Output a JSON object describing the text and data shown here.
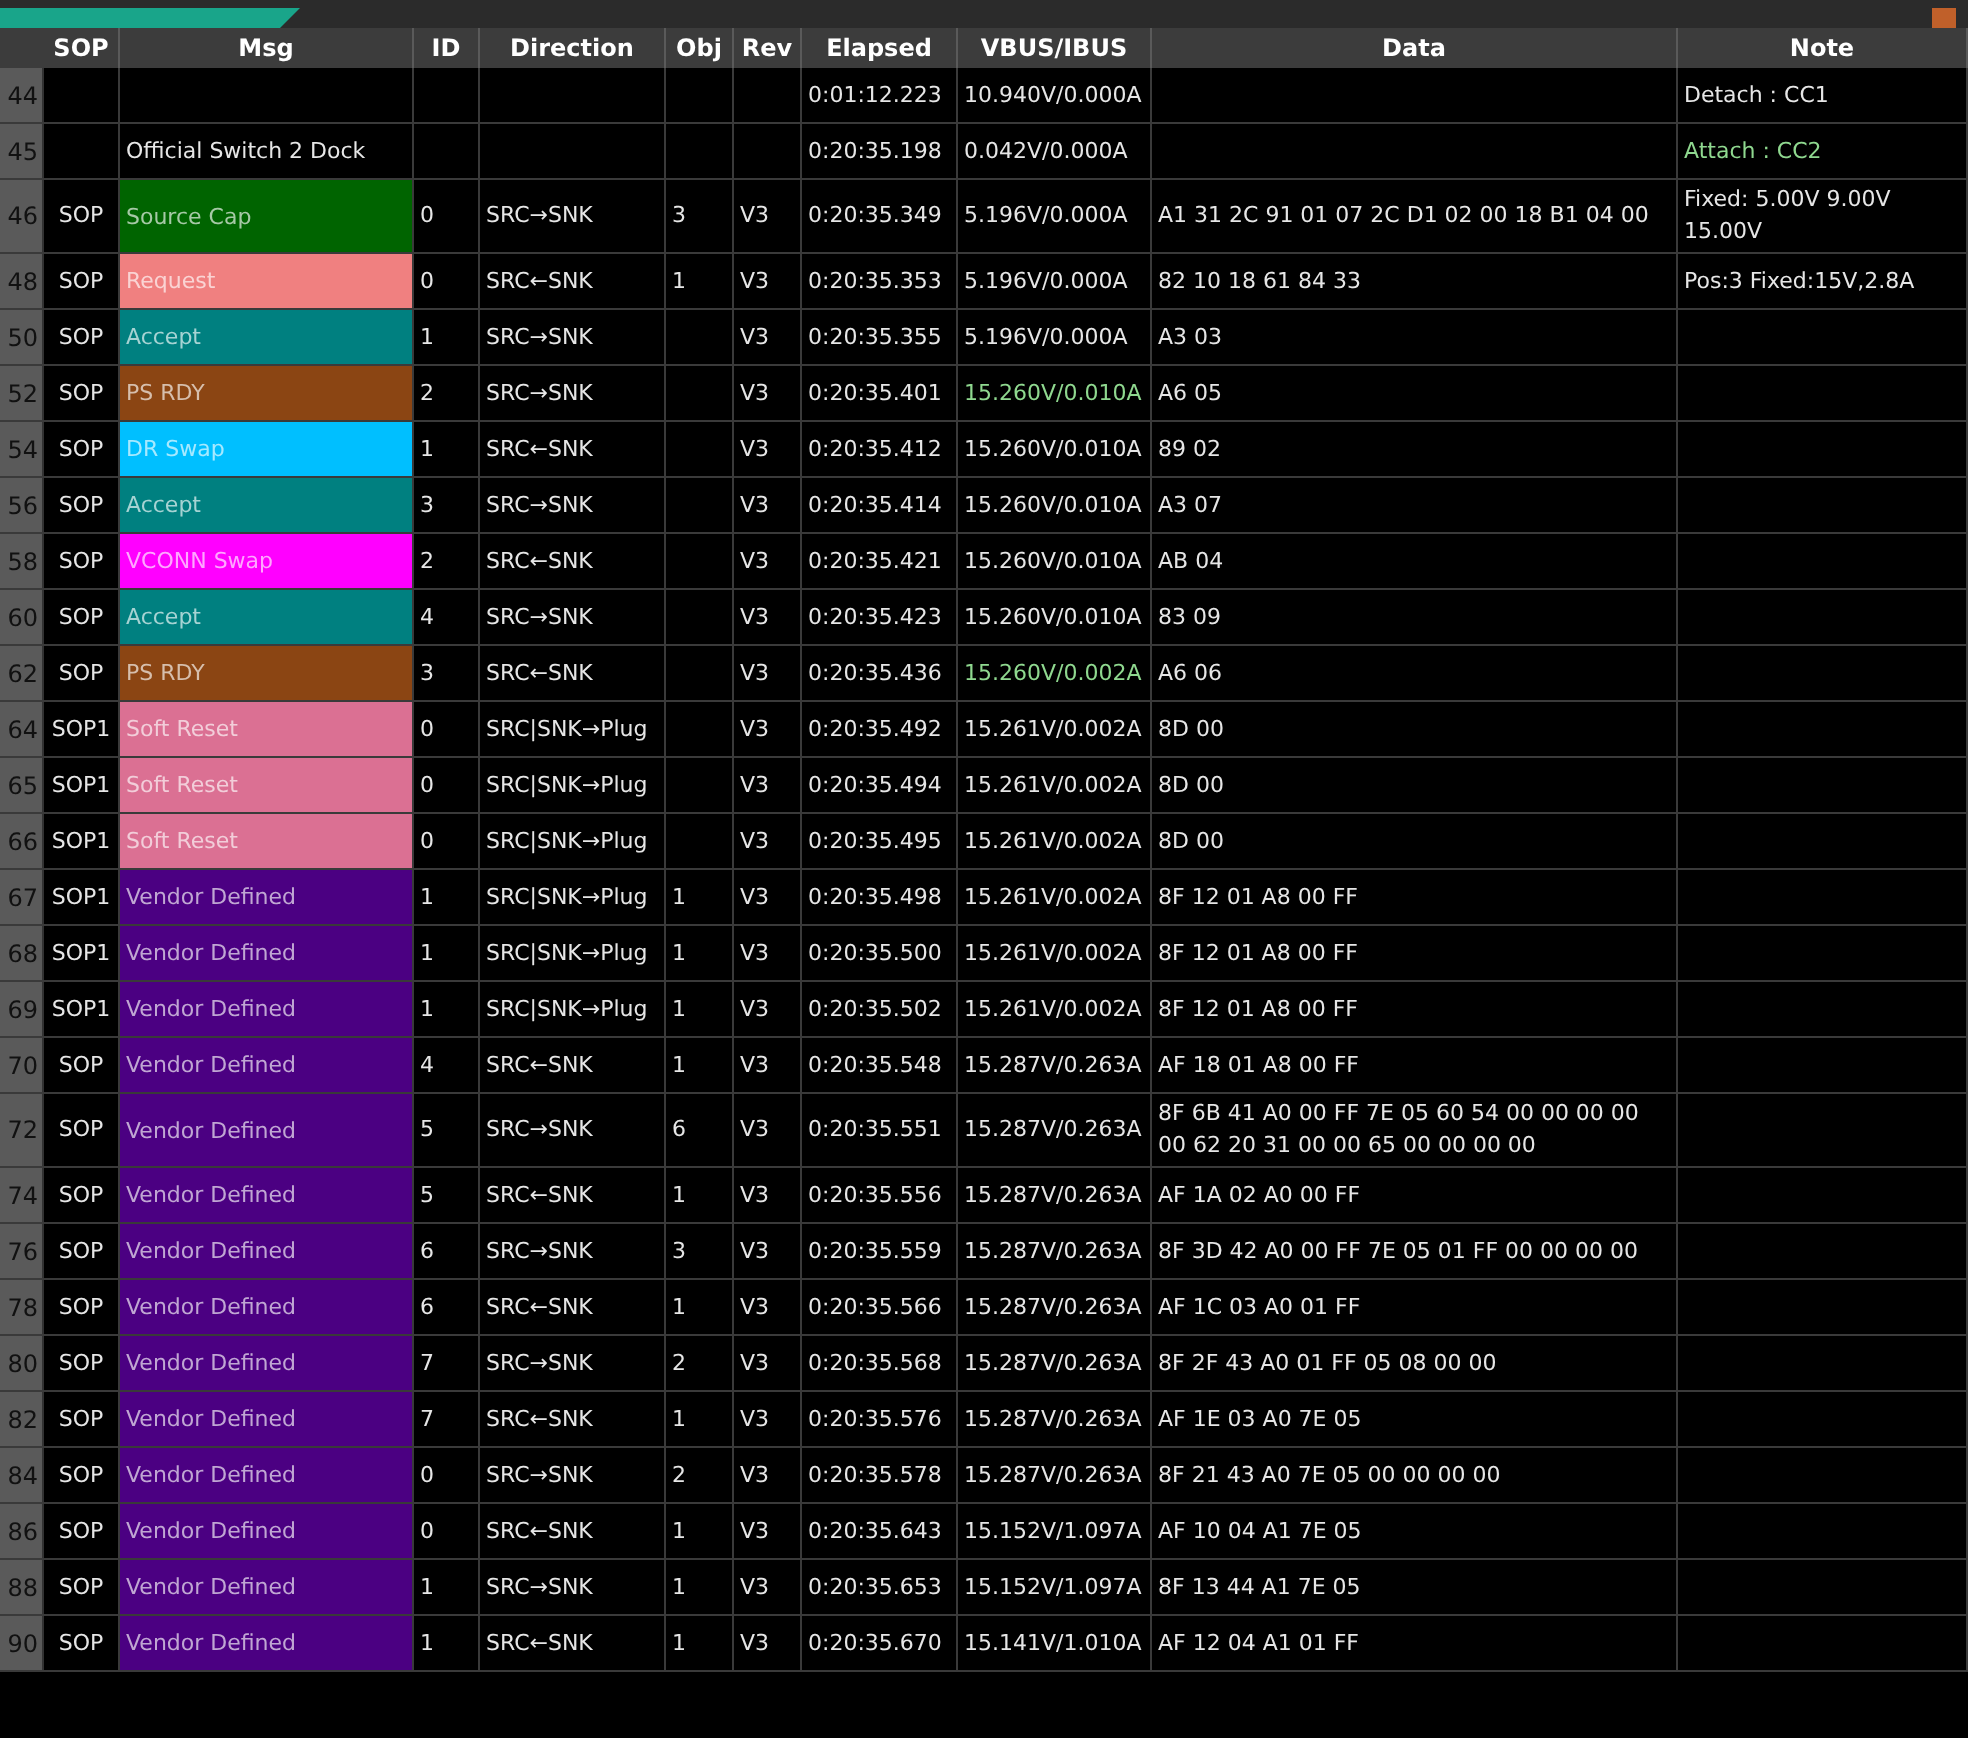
{
  "table": {
    "columns": [
      "SOP",
      "Msg",
      "ID",
      "Direction",
      "Obj",
      "Rev",
      "Elapsed",
      "VBUS/IBUS",
      "Data",
      "Note"
    ],
    "rows": [
      {
        "index": "44",
        "elapsed": "0:01:12.223",
        "vbus": "10.940V/0.000A",
        "vbus_highlight": false,
        "note": "Detach : CC1",
        "note_highlight": false
      },
      {
        "index": "45",
        "msg": "Official Switch 2 Dock",
        "elapsed": "0:20:35.198",
        "vbus": "0.042V/0.000A",
        "vbus_highlight": false,
        "note": "Attach : CC2",
        "note_highlight": true
      },
      {
        "index": "46",
        "sop": "SOP",
        "msg": "Source Cap",
        "color": "#006400",
        "id": "0",
        "direction": "SRC→SNK",
        "obj": "3",
        "rev": "V3",
        "elapsed": "0:20:35.349",
        "vbus": "5.196V/0.000A",
        "vbus_highlight": false,
        "data": "A1 31 2C 91 01 07 2C D1 02 00 18 B1 04 00",
        "note": "Fixed: 5.00V  9.00V  15.00V",
        "note_highlight": false
      },
      {
        "index": "48",
        "sop": "SOP",
        "msg": "Request",
        "color": "#f08080",
        "id": "0",
        "direction": "SRC←SNK",
        "obj": "1",
        "rev": "V3",
        "elapsed": "0:20:35.353",
        "vbus": "5.196V/0.000A",
        "vbus_highlight": false,
        "data": "82 10 18 61 84 33",
        "note": "Pos:3 Fixed:15V,2.8A",
        "note_highlight": false
      },
      {
        "index": "50",
        "sop": "SOP",
        "msg": "Accept",
        "color": "#008080",
        "id": "1",
        "direction": "SRC→SNK",
        "rev": "V3",
        "elapsed": "0:20:35.355",
        "vbus": "5.196V/0.000A",
        "vbus_highlight": false,
        "data": "A3 03"
      },
      {
        "index": "52",
        "sop": "SOP",
        "msg": "PS RDY",
        "color": "#8b4513",
        "id": "2",
        "direction": "SRC→SNK",
        "rev": "V3",
        "elapsed": "0:20:35.401",
        "vbus": "15.260V/0.010A",
        "vbus_highlight": true,
        "data": "A6 05"
      },
      {
        "index": "54",
        "sop": "SOP",
        "msg": "DR Swap",
        "color": "#00bfff",
        "id": "1",
        "direction": "SRC←SNK",
        "rev": "V3",
        "elapsed": "0:20:35.412",
        "vbus": "15.260V/0.010A",
        "vbus_highlight": false,
        "data": "89 02"
      },
      {
        "index": "56",
        "sop": "SOP",
        "msg": "Accept",
        "color": "#008080",
        "id": "3",
        "direction": "SRC→SNK",
        "rev": "V3",
        "elapsed": "0:20:35.414",
        "vbus": "15.260V/0.010A",
        "vbus_highlight": false,
        "data": "A3 07"
      },
      {
        "index": "58",
        "sop": "SOP",
        "msg": "VCONN Swap",
        "color": "#ff00ff",
        "id": "2",
        "direction": "SRC←SNK",
        "rev": "V3",
        "elapsed": "0:20:35.421",
        "vbus": "15.260V/0.010A",
        "vbus_highlight": false,
        "data": "AB 04"
      },
      {
        "index": "60",
        "sop": "SOP",
        "msg": "Accept",
        "color": "#008080",
        "id": "4",
        "direction": "SRC→SNK",
        "rev": "V3",
        "elapsed": "0:20:35.423",
        "vbus": "15.260V/0.010A",
        "vbus_highlight": false,
        "data": "83 09"
      },
      {
        "index": "62",
        "sop": "SOP",
        "msg": "PS RDY",
        "color": "#8b4513",
        "id": "3",
        "direction": "SRC←SNK",
        "rev": "V3",
        "elapsed": "0:20:35.436",
        "vbus": "15.260V/0.002A",
        "vbus_highlight": true,
        "data": "A6 06"
      },
      {
        "index": "64",
        "sop": "SOP1",
        "msg": "Soft Reset",
        "color": "#db7093",
        "id": "0",
        "direction": "SRC|SNK→Plug",
        "rev": "V3",
        "elapsed": "0:20:35.492",
        "vbus": "15.261V/0.002A",
        "vbus_highlight": false,
        "data": "8D 00"
      },
      {
        "index": "65",
        "sop": "SOP1",
        "msg": "Soft Reset",
        "color": "#db7093",
        "id": "0",
        "direction": "SRC|SNK→Plug",
        "rev": "V3",
        "elapsed": "0:20:35.494",
        "vbus": "15.261V/0.002A",
        "vbus_highlight": false,
        "data": "8D 00"
      },
      {
        "index": "66",
        "sop": "SOP1",
        "msg": "Soft Reset",
        "color": "#db7093",
        "id": "0",
        "direction": "SRC|SNK→Plug",
        "rev": "V3",
        "elapsed": "0:20:35.495",
        "vbus": "15.261V/0.002A",
        "vbus_highlight": false,
        "data": "8D 00"
      },
      {
        "index": "67",
        "sop": "SOP1",
        "msg": "Vendor Defined",
        "color": "#4b0082",
        "id": "1",
        "direction": "SRC|SNK→Plug",
        "obj": "1",
        "rev": "V3",
        "elapsed": "0:20:35.498",
        "vbus": "15.261V/0.002A",
        "vbus_highlight": false,
        "data": "8F 12 01 A8 00 FF"
      },
      {
        "index": "68",
        "sop": "SOP1",
        "msg": "Vendor Defined",
        "color": "#4b0082",
        "id": "1",
        "direction": "SRC|SNK→Plug",
        "obj": "1",
        "rev": "V3",
        "elapsed": "0:20:35.500",
        "vbus": "15.261V/0.002A",
        "vbus_highlight": false,
        "data": "8F 12 01 A8 00 FF"
      },
      {
        "index": "69",
        "sop": "SOP1",
        "msg": "Vendor Defined",
        "color": "#4b0082",
        "id": "1",
        "direction": "SRC|SNK→Plug",
        "obj": "1",
        "rev": "V3",
        "elapsed": "0:20:35.502",
        "vbus": "15.261V/0.002A",
        "vbus_highlight": false,
        "data": "8F 12 01 A8 00 FF"
      },
      {
        "index": "70",
        "sop": "SOP",
        "msg": "Vendor Defined",
        "color": "#4b0082",
        "id": "4",
        "direction": "SRC←SNK",
        "obj": "1",
        "rev": "V3",
        "elapsed": "0:20:35.548",
        "vbus": "15.287V/0.263A",
        "vbus_highlight": false,
        "data": "AF 18 01 A8 00 FF"
      },
      {
        "index": "72",
        "sop": "SOP",
        "msg": "Vendor Defined",
        "color": "#4b0082",
        "id": "5",
        "direction": "SRC→SNK",
        "obj": "6",
        "rev": "V3",
        "elapsed": "0:20:35.551",
        "vbus": "15.287V/0.263A",
        "vbus_highlight": false,
        "data": "8F 6B 41 A0 00 FF 7E 05 60 54 00 00 00 00 00 62 20 31 00 00 65 00 00 00 00"
      },
      {
        "index": "74",
        "sop": "SOP",
        "msg": "Vendor Defined",
        "color": "#4b0082",
        "id": "5",
        "direction": "SRC←SNK",
        "obj": "1",
        "rev": "V3",
        "elapsed": "0:20:35.556",
        "vbus": "15.287V/0.263A",
        "vbus_highlight": false,
        "data": "AF 1A 02 A0 00 FF"
      },
      {
        "index": "76",
        "sop": "SOP",
        "msg": "Vendor Defined",
        "color": "#4b0082",
        "id": "6",
        "direction": "SRC→SNK",
        "obj": "3",
        "rev": "V3",
        "elapsed": "0:20:35.559",
        "vbus": "15.287V/0.263A",
        "vbus_highlight": false,
        "data": "8F 3D 42 A0 00 FF 7E 05 01 FF 00 00 00 00"
      },
      {
        "index": "78",
        "sop": "SOP",
        "msg": "Vendor Defined",
        "color": "#4b0082",
        "id": "6",
        "direction": "SRC←SNK",
        "obj": "1",
        "rev": "V3",
        "elapsed": "0:20:35.566",
        "vbus": "15.287V/0.263A",
        "vbus_highlight": false,
        "data": "AF 1C 03 A0 01 FF"
      },
      {
        "index": "80",
        "sop": "SOP",
        "msg": "Vendor Defined",
        "color": "#4b0082",
        "id": "7",
        "direction": "SRC→SNK",
        "obj": "2",
        "rev": "V3",
        "elapsed": "0:20:35.568",
        "vbus": "15.287V/0.263A",
        "vbus_highlight": false,
        "data": "8F 2F 43 A0 01 FF 05 08 00 00"
      },
      {
        "index": "82",
        "sop": "SOP",
        "msg": "Vendor Defined",
        "color": "#4b0082",
        "id": "7",
        "direction": "SRC←SNK",
        "obj": "1",
        "rev": "V3",
        "elapsed": "0:20:35.576",
        "vbus": "15.287V/0.263A",
        "vbus_highlight": false,
        "data": "AF 1E 03 A0 7E 05"
      },
      {
        "index": "84",
        "sop": "SOP",
        "msg": "Vendor Defined",
        "color": "#4b0082",
        "id": "0",
        "direction": "SRC→SNK",
        "obj": "2",
        "rev": "V3",
        "elapsed": "0:20:35.578",
        "vbus": "15.287V/0.263A",
        "vbus_highlight": false,
        "data": "8F 21 43 A0 7E 05 00 00 00 00"
      },
      {
        "index": "86",
        "sop": "SOP",
        "msg": "Vendor Defined",
        "color": "#4b0082",
        "id": "0",
        "direction": "SRC←SNK",
        "obj": "1",
        "rev": "V3",
        "elapsed": "0:20:35.643",
        "vbus": "15.152V/1.097A",
        "vbus_highlight": false,
        "data": "AF 10 04 A1 7E 05"
      },
      {
        "index": "88",
        "sop": "SOP",
        "msg": "Vendor Defined",
        "color": "#4b0082",
        "id": "1",
        "direction": "SRC→SNK",
        "obj": "1",
        "rev": "V3",
        "elapsed": "0:20:35.653",
        "vbus": "15.152V/1.097A",
        "vbus_highlight": false,
        "data": "8F 13 44 A1 7E 05"
      },
      {
        "index": "90",
        "sop": "SOP",
        "msg": "Vendor Defined",
        "color": "#4b0082",
        "id": "1",
        "direction": "SRC←SNK",
        "obj": "1",
        "rev": "V3",
        "elapsed": "0:20:35.670",
        "vbus": "15.141V/1.010A",
        "vbus_highlight": false,
        "data": "AF 12 04 A1 01 FF"
      }
    ]
  }
}
